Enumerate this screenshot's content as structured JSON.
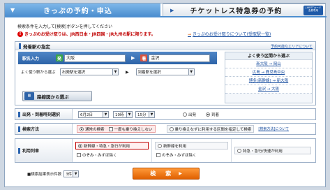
{
  "tabs": {
    "active_label": "きっぷの予約・申込",
    "inactive_label": "チケットレス特急券の予約",
    "badge_lines": [
      "J-WESTカード",
      "会員専用"
    ]
  },
  "notices": {
    "instruction": "検索条件を入力して[検索]ボタンを押してください",
    "warning": "きっぷのお受け取りは、JR西日本・JR四国・JR九州の駅に限ります。",
    "link": "きっぷのお受け取りについて(受取駅一覧)"
  },
  "station": {
    "heading": "発着駅の指定",
    "help_link": "予約可能なエリアについて",
    "input_label": "駅名入力",
    "from_badge": "発",
    "to_badge": "着",
    "from_value": "大阪",
    "to_value": "金沢",
    "select_label": "よく使う駅から選ぶ",
    "from_select": "出発駅を選択",
    "to_select": "到着駅を選択",
    "route_button": "路線図から選ぶ",
    "frequent_heading": "よく使う区間から選ぶ",
    "frequent_routes": [
      "新大阪 → 岡山",
      "広島 → 鹿児島中央",
      "博多(新幹線) → 新大阪",
      "金沢 → 大阪"
    ]
  },
  "datetime": {
    "label": "出発・到着時刻選択",
    "date": "6月2日",
    "hour": "10時",
    "minute": "15分",
    "depart_label": "出発",
    "arrive_label": "到着",
    "selected": "arrive"
  },
  "search_method": {
    "label": "検索方法",
    "option_normal": "通常の検索",
    "option_once": "一度も乗り換えしない",
    "option_transfer": "乗り換えなずに利用する区間を指定して検索",
    "link": "[検索方法]について"
  },
  "trains": {
    "label": "利用列車",
    "option1": "新幹線・特急・急行が利用",
    "option1_sub": "のぞみ・みずほ除く",
    "option2": "新幹線を利用",
    "option2_sub": "のぞみ・みずほ除く",
    "option3": "特急・急行/快速が利用"
  },
  "results": {
    "label": "■検索結果表示件数",
    "count": "3件"
  },
  "search_button": "検　索"
}
